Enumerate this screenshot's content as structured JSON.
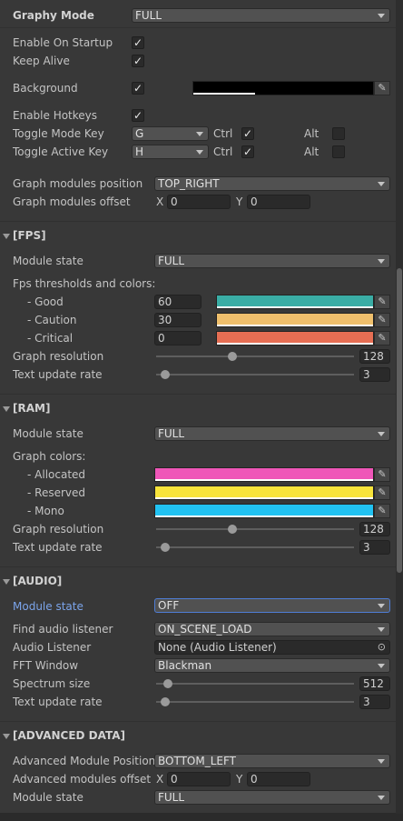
{
  "colors": {
    "good": "#3aada5",
    "caution": "#efbf6c",
    "critical": "#e66e53",
    "allocated": "#ef56b8",
    "reserved": "#f8e43a",
    "mono": "#21c2f2",
    "background": "#000000"
  },
  "top": {
    "graphy_mode_label": "Graphy Mode",
    "graphy_mode_value": "FULL",
    "enable_on_startup_label": "Enable On Startup",
    "enable_on_startup_checked": true,
    "keep_alive_label": "Keep Alive",
    "keep_alive_checked": true,
    "background_label": "Background",
    "background_checked": true,
    "enable_hotkeys_label": "Enable Hotkeys",
    "enable_hotkeys_checked": true,
    "toggle_mode_key_label": "Toggle Mode Key",
    "toggle_mode_key_value": "G",
    "toggle_active_key_label": "Toggle Active Key",
    "toggle_active_key_value": "H",
    "ctrl_label": "Ctrl",
    "alt_label": "Alt",
    "graph_modules_position_label": "Graph modules position",
    "graph_modules_position_value": "TOP_RIGHT",
    "graph_modules_offset_label": "Graph modules offset",
    "x_label": "X",
    "y_label": "Y",
    "offset_x": "0",
    "offset_y": "0"
  },
  "fps": {
    "title": "[FPS]",
    "module_state_label": "Module state",
    "module_state_value": "FULL",
    "thresholds_label": "Fps thresholds and colors:",
    "good_label": "- Good",
    "good_value": "60",
    "caution_label": "- Caution",
    "caution_value": "30",
    "critical_label": "- Critical",
    "critical_value": "0",
    "graph_resolution_label": "Graph resolution",
    "graph_resolution_value": "128",
    "text_update_rate_label": "Text update rate",
    "text_update_rate_value": "3"
  },
  "ram": {
    "title": "[RAM]",
    "module_state_label": "Module state",
    "module_state_value": "FULL",
    "graph_colors_label": "Graph colors:",
    "allocated_label": "- Allocated",
    "reserved_label": "- Reserved",
    "mono_label": "- Mono",
    "graph_resolution_label": "Graph resolution",
    "graph_resolution_value": "128",
    "text_update_rate_label": "Text update rate",
    "text_update_rate_value": "3"
  },
  "audio": {
    "title": "[AUDIO]",
    "module_state_label": "Module state",
    "module_state_value": "OFF",
    "find_audio_listener_label": "Find audio listener",
    "find_audio_listener_value": "ON_SCENE_LOAD",
    "audio_listener_label": "Audio Listener",
    "audio_listener_value": "None (Audio Listener)",
    "fft_window_label": "FFT Window",
    "fft_window_value": "Blackman",
    "spectrum_size_label": "Spectrum size",
    "spectrum_size_value": "512",
    "text_update_rate_label": "Text update rate",
    "text_update_rate_value": "3"
  },
  "advanced": {
    "title": "[ADVANCED DATA]",
    "position_label": "Advanced Module Position",
    "position_value": "BOTTOM_LEFT",
    "offset_label": "Advanced modules offset",
    "x_label": "X",
    "y_label": "Y",
    "offset_x": "0",
    "offset_y": "0",
    "module_state_label": "Module state",
    "module_state_value": "FULL"
  }
}
